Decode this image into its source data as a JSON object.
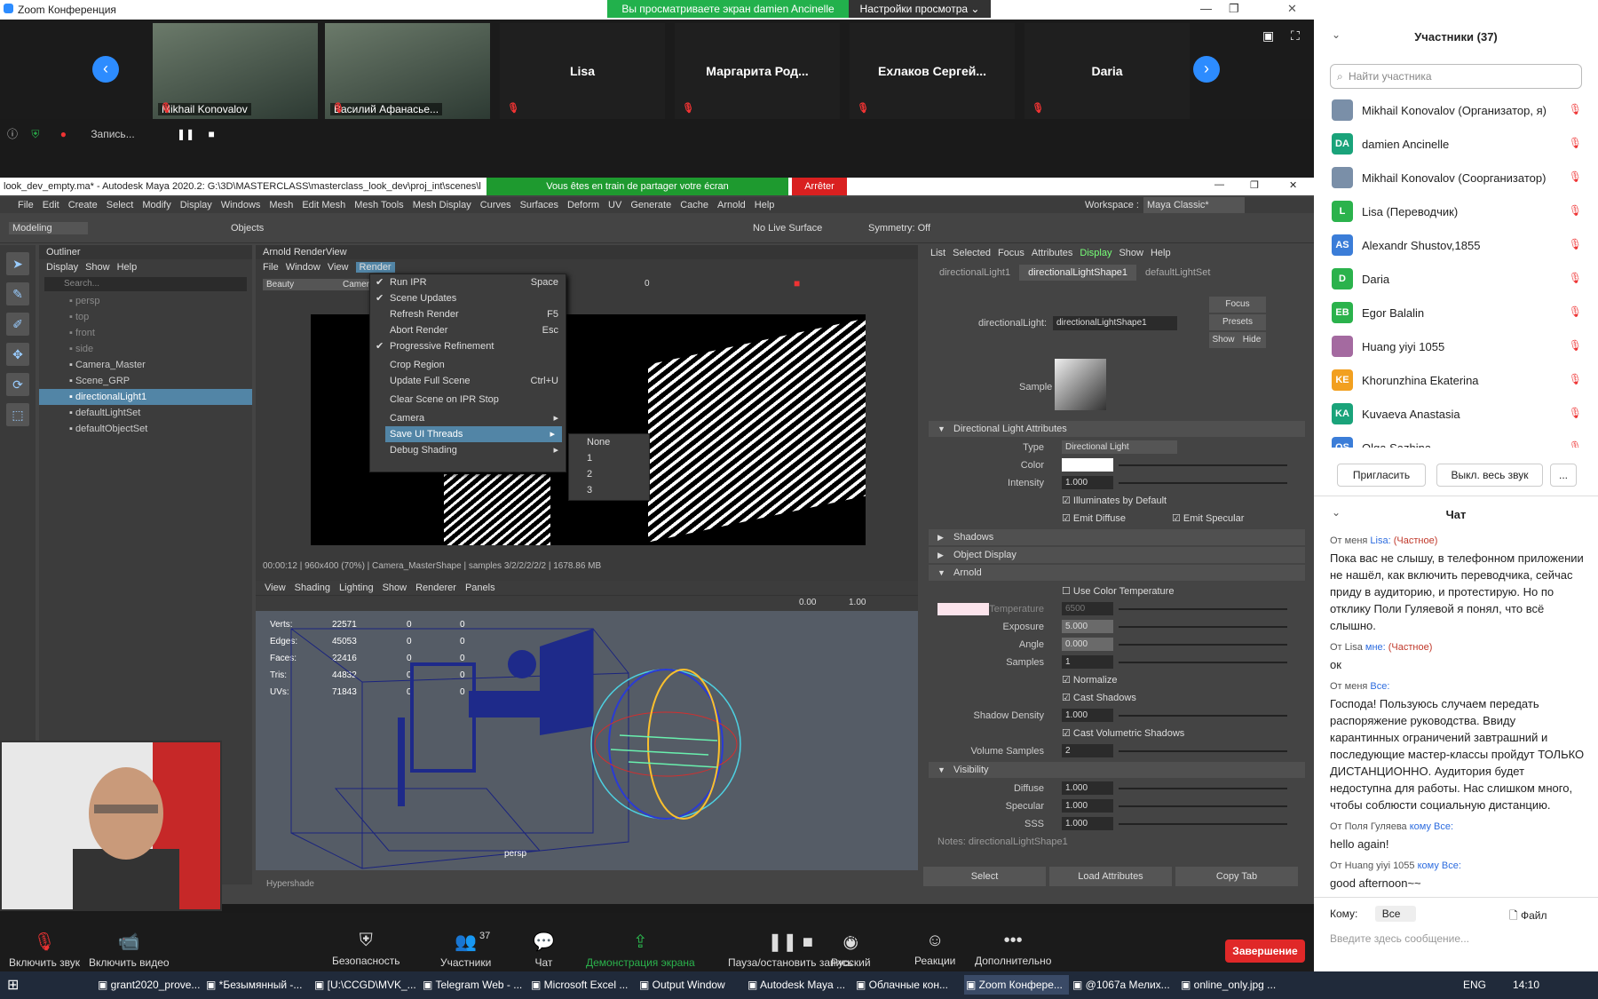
{
  "zoom": {
    "title": "Zoom Конференция",
    "viewing_banner": "Вы просматриваете экран damien Ancinelle",
    "view_options": "Настройки просмотра",
    "participants_strip": [
      {
        "name": "Mikhail Konovalov",
        "video": true
      },
      {
        "name": "Василий Афанасье...",
        "video": true
      },
      {
        "name": "Lisa",
        "video": false
      },
      {
        "name": "Маргарита  Род...",
        "video": false
      },
      {
        "name": "Ехлаков  Сергей...",
        "video": false
      },
      {
        "name": "Daria",
        "video": false
      }
    ],
    "recording_label": "Запись...",
    "bottom_bar": [
      {
        "label": "Включить звук",
        "icon": "mic-muted-icon"
      },
      {
        "label": "Включить видео",
        "icon": "video-off-icon"
      },
      {
        "label": "Безопасность",
        "icon": "shield-icon"
      },
      {
        "label": "Участники",
        "icon": "participants-icon",
        "count": "37"
      },
      {
        "label": "Чат",
        "icon": "chat-icon"
      },
      {
        "label": "Демонстрация экрана",
        "icon": "share-screen-icon"
      },
      {
        "label": "Пауза/остановить запись",
        "icon": "pause-record-icon"
      },
      {
        "label": "Русский",
        "icon": "language-icon",
        "badge": "RU"
      },
      {
        "label": "Реакции",
        "icon": "reactions-icon"
      },
      {
        "label": "Дополнительно",
        "icon": "more-icon"
      }
    ],
    "end_button": "Завершение"
  },
  "maya": {
    "window_title": "look_dev_empty.ma* - Autodesk Maya 2020.2: G:\\3D\\MASTERCLASS\\masterclass_look_dev\\proj_int\\scenes\\l",
    "share_banner": "Vous êtes en train de partager votre écran",
    "stop_button": "Arrêter",
    "menus": [
      "File",
      "Edit",
      "Create",
      "Select",
      "Modify",
      "Display",
      "Windows",
      "Mesh",
      "Edit Mesh",
      "Mesh Tools",
      "Mesh Display",
      "Curves",
      "Surfaces",
      "Deform",
      "UV",
      "Generate",
      "Cache",
      "Arnold",
      "Help"
    ],
    "workspace_label": "Workspace :",
    "workspace_value": "Maya Classic*",
    "mode": "Modeling",
    "objects_label": "Objects",
    "no_live_surface": "No Live Surface",
    "symmetry": "Symmetry: Off",
    "outliner": {
      "title": "Outliner",
      "menu": [
        "Display",
        "Show",
        "Help"
      ],
      "search_placeholder": "Search...",
      "items": [
        {
          "label": "persp",
          "state": "dim"
        },
        {
          "label": "top",
          "state": "dim"
        },
        {
          "label": "front",
          "state": "dim"
        },
        {
          "label": "side",
          "state": "dim"
        },
        {
          "label": "Camera_Master",
          "state": ""
        },
        {
          "label": "Scene_GRP",
          "state": ""
        },
        {
          "label": "directionalLight1",
          "state": "sel"
        },
        {
          "label": "defaultLightSet",
          "state": ""
        },
        {
          "label": "defaultObjectSet",
          "state": ""
        }
      ]
    },
    "renderview": {
      "title": "Arnold RenderView",
      "menu": [
        "File",
        "Window",
        "View",
        "Render"
      ],
      "aov": "Beauty",
      "camera": "Camer",
      "value": "0",
      "status": "00:00:12 | 960x400 (70%) | Camera_MasterShape | samples 3/2/2/2/2/2 | 1678.86 MB",
      "render_menu": [
        {
          "label": "Run IPR",
          "shortcut": "Space",
          "checked": true
        },
        {
          "label": "Scene Updates",
          "shortcut": "",
          "checked": true
        },
        {
          "label": "Refresh Render",
          "shortcut": "F5",
          "checked": false
        },
        {
          "label": "Abort Render",
          "shortcut": "Esc",
          "checked": false
        },
        {
          "label": "Progressive Refinement",
          "shortcut": "",
          "checked": true
        },
        {
          "label": "Crop Region",
          "shortcut": "",
          "checked": false
        },
        {
          "label": "Update Full Scene",
          "shortcut": "Ctrl+U",
          "checked": false
        },
        {
          "label": "Clear Scene on IPR Stop",
          "shortcut": "",
          "checked": false
        },
        {
          "label": "Camera",
          "shortcut": "▸",
          "checked": false
        },
        {
          "label": "Save UI Threads",
          "shortcut": "▸",
          "checked": false
        },
        {
          "label": "Debug Shading",
          "shortcut": "▸",
          "checked": false
        }
      ],
      "submenu": [
        "None",
        "1",
        "2",
        "3"
      ]
    },
    "viewport": {
      "menu": [
        "View",
        "Shading",
        "Lighting",
        "Show",
        "Renderer",
        "Panels"
      ],
      "field1": "0.00",
      "field2": "1.00",
      "hud": [
        {
          "label": "Verts:",
          "v1": "22571",
          "v2": "0",
          "v3": "0"
        },
        {
          "label": "Edges:",
          "v1": "45053",
          "v2": "0",
          "v3": "0"
        },
        {
          "label": "Faces:",
          "v1": "22416",
          "v2": "0",
          "v3": "0"
        },
        {
          "label": "Tris:",
          "v1": "44832",
          "v2": "0",
          "v3": "0"
        },
        {
          "label": "UVs:",
          "v1": "71843",
          "v2": "0",
          "v3": "0"
        }
      ],
      "camera_label": "persp",
      "hypershade": "Hypershade"
    },
    "attr_editor": {
      "menu": [
        "List",
        "Selected",
        "Focus",
        "Attributes",
        "Display",
        "Show",
        "Help"
      ],
      "tabs": [
        "directionalLight1",
        "directionalLightShape1",
        "defaultLightSet"
      ],
      "node_label": "directionalLight:",
      "node_value": "directionalLightShape1",
      "buttons": [
        "Focus",
        "Presets",
        "Show",
        "Hide"
      ],
      "sample_label": "Sample",
      "section1": "Directional Light Attributes",
      "type_label": "Type",
      "type_value": "Directional Light",
      "color_label": "Color",
      "intensity_label": "Intensity",
      "intensity_value": "1.000",
      "illum_default": "Illuminates by Default",
      "emit_diffuse": "Emit Diffuse",
      "emit_specular": "Emit Specular",
      "shadows": "Shadows",
      "object_display": "Object Display",
      "arnold": "Arnold",
      "use_color_temp": "Use Color Temperature",
      "temperature_label": "Temperature",
      "temperature_value": "6500",
      "exposure_label": "Exposure",
      "exposure_value": "5.000",
      "angle_label": "Angle",
      "angle_value": "0.000",
      "samples_label": "Samples",
      "samples_value": "1",
      "normalize": "Normalize",
      "cast_shadows": "Cast Shadows",
      "shadow_density_label": "Shadow Density",
      "shadow_density_value": "1.000",
      "cast_vol_shadows": "Cast Volumetric Shadows",
      "volume_samples_label": "Volume Samples",
      "volume_samples_value": "2",
      "visibility": "Visibility",
      "diffuse_label": "Diffuse",
      "diffuse_value": "1.000",
      "specular_label": "Specular",
      "specular_value": "1.000",
      "sss_label": "SSS",
      "sss_value": "1.000",
      "notes": "Notes: directionalLightShape1",
      "bottom_buttons": [
        "Select",
        "Load Attributes",
        "Copy Tab"
      ]
    }
  },
  "panel": {
    "participants_title": "Участники (37)",
    "search_placeholder": "Найти участника",
    "participants": [
      {
        "initials": "",
        "name": "Mikhail Konovalov (Организатор, я)",
        "color": "#7a8fa8"
      },
      {
        "initials": "DA",
        "name": "damien Ancinelle",
        "color": "#1aa37a"
      },
      {
        "initials": "",
        "name": "Mikhail Konovalov (Соорганизатор)",
        "color": "#7a8fa8"
      },
      {
        "initials": "L",
        "name": "Lisa (Переводчик)",
        "color": "#2bb24c"
      },
      {
        "initials": "AS",
        "name": "Alexandr Shustov,1855",
        "color": "#3b7dd8"
      },
      {
        "initials": "D",
        "name": "Daria",
        "color": "#2bb24c"
      },
      {
        "initials": "EB",
        "name": "Egor Balalin",
        "color": "#2bb24c"
      },
      {
        "initials": "",
        "name": "Huang yiyi 1055",
        "color": "#a46aa0"
      },
      {
        "initials": "KE",
        "name": "Khorunzhina Ekaterina",
        "color": "#f2a020"
      },
      {
        "initials": "KA",
        "name": "Kuvaeva Anastasia",
        "color": "#1aa37a"
      },
      {
        "initials": "OS",
        "name": "Olga Sazhina",
        "color": "#3b7dd8"
      }
    ],
    "invite": "Пригласить",
    "mute_all": "Выкл. весь звук",
    "more": "...",
    "chat_title": "Чат",
    "messages": [
      {
        "from": "От меня",
        "to": "Lisa:",
        "private": "(Частное)",
        "text": "Пока вас не слышу, в телефонном приложении не нашёл, как включить переводчика, сейчас приду в аудиторию, и протестирую. Но по отклику Поли Гуляевой я понял, что всё слышно."
      },
      {
        "from": "От Lisa",
        "to": "мне:",
        "private": "(Частное)",
        "text": "ок"
      },
      {
        "from": "От меня",
        "to": "Все:",
        "private": "",
        "text": "Господа! Пользуюсь случаем передать распоряжение руководства. Ввиду карантинных ограничений завтрашний и последующие мастер-классы пройдут ТОЛЬКО ДИСТАНЦИОННО. Аудитория будет недоступна для работы. Нас слишком много, чтобы соблюсти социальную дистанцию."
      },
      {
        "from": "От Поля Гуляева",
        "to": "кому Все:",
        "private": "",
        "text": "hello again!"
      },
      {
        "from": "От Huang yiyi 1055",
        "to": "кому Все:",
        "private": "",
        "text": "good afternoon~~"
      }
    ],
    "to_label": "Кому:",
    "to_value": "Все",
    "file_label": "Файл",
    "message_placeholder": "Введите здесь сообщение..."
  },
  "taskbar": {
    "items": [
      "grant2020_prove...",
      "*Безымянный -...",
      "[U:\\CCGD\\MVK_...",
      "Telegram Web - ...",
      "Microsoft Excel ...",
      "Output Window",
      "Autodesk Maya ...",
      "Облачные кон...",
      "Zoom Конфере...",
      "@1067a Мелих...",
      "online_only.jpg ..."
    ],
    "lang": "ENG",
    "time": "14:10"
  }
}
